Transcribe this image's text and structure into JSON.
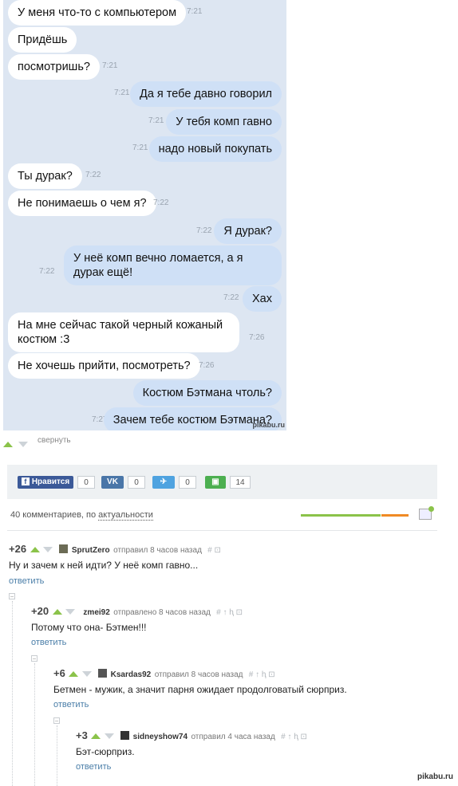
{
  "chat": {
    "messages": [
      {
        "text": "У меня что-то с компьютером",
        "time": "7:21",
        "dir": "in"
      },
      {
        "text": "Придёшь",
        "time": "",
        "dir": "in"
      },
      {
        "text": "посмотришь?",
        "time": "7:21",
        "dir": "in"
      },
      {
        "text": "Да я тебе давно говорил",
        "time": "7:21",
        "dir": "out"
      },
      {
        "text": "У тебя комп гавно",
        "time": "7:21",
        "dir": "out"
      },
      {
        "text": "надо новый покупать",
        "time": "7:21",
        "dir": "out"
      },
      {
        "text": "Ты дурак?",
        "time": "7:22",
        "dir": "in"
      },
      {
        "text": "Не понимаешь о чем я?",
        "time": "7:22",
        "dir": "in"
      },
      {
        "text": "Я дурак?",
        "time": "7:22",
        "dir": "out"
      },
      {
        "text": "У неё комп вечно ломается, а я дурак ещё!",
        "time": "7:22",
        "dir": "out"
      },
      {
        "text": "Хах",
        "time": "7:22",
        "dir": "out"
      },
      {
        "text": "На мне сейчас такой черный кожаный костюм :3",
        "time": "7:26",
        "dir": "in"
      },
      {
        "text": "Не хочешь прийти, посмотреть?",
        "time": "7:26",
        "dir": "in"
      },
      {
        "text": "Костюм Бэтмана чтоль?",
        "time": "",
        "dir": "out"
      },
      {
        "text": "Зачем тебе костюм Бэтмана?",
        "time": "7:27",
        "dir": "out"
      }
    ],
    "watermark": "pikabu.ru"
  },
  "post": {
    "collapse_label": "свернуть"
  },
  "share": {
    "facebook_label": "Нравится",
    "facebook_count": "0",
    "vk_count": "0",
    "twitter_count": "0",
    "save_count": "14"
  },
  "comments_header": {
    "count_text": "40 комментариев, по",
    "sort_label": "актуальности"
  },
  "comments": [
    {
      "score": "+26",
      "user": "SprutZero",
      "meta": "отправил 8 часов назад",
      "text": "Ну и зачем к ней идти? У неё комп гавно...",
      "reply": "ответить"
    },
    {
      "score": "+20",
      "user": "zmei92",
      "meta": "отправлено 8 часов назад",
      "text": "Потому что она- Бэтмен!!!",
      "reply": "ответить"
    },
    {
      "score": "+6",
      "user": "Ksardas92",
      "meta": "отправил 8 часов назад",
      "text": "Бетмен - мужик, а значит парня ожидает продолговатый сюрприз.",
      "reply": "ответить"
    },
    {
      "score": "+3",
      "user": "sidneyshow74",
      "meta": "отправил 4 часа назад",
      "text": "Бэт-сюрприз.",
      "reply": "ответить"
    }
  ],
  "footer_watermark": "pikabu.ru",
  "colors": {
    "accent_green": "#8bc34a",
    "link": "#4a7ea8",
    "chat_bg": "#dde6f2",
    "out_bubble": "#cfe0f6"
  }
}
